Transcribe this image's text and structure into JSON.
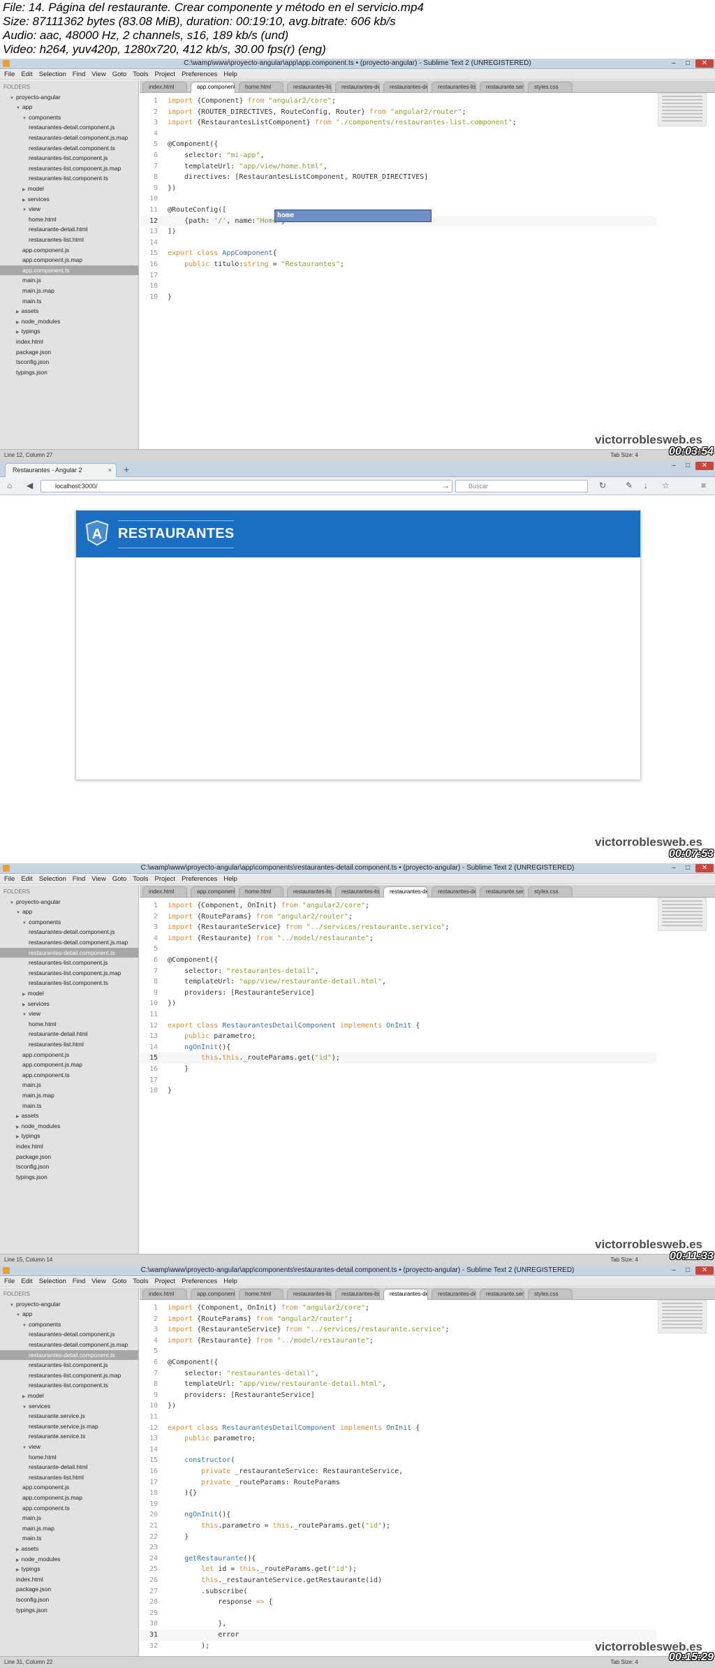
{
  "file_info": {
    "lines": [
      "File: 14. Página del restaurante. Crear componente y método en el servicio.mp4",
      "Size: 87111362 bytes (83.08 MiB), duration: 00:19:10, avg.bitrate: 606 kb/s",
      "Audio: aac, 48000 Hz, 2 channels, s16, 189 kb/s (und)",
      "Video: h264, yuv420p, 1280x720, 412 kb/s, 30.00 fps(r) (eng)"
    ]
  },
  "watermark": "victorroblesweb.es",
  "menu": [
    "File",
    "Edit",
    "Selection",
    "Find",
    "View",
    "Goto",
    "Tools",
    "Project",
    "Preferences",
    "Help"
  ],
  "window_controls": {
    "minimize": "–",
    "maximize": "□",
    "close": "✕"
  },
  "tree_icons": {
    "open": "▼",
    "closed": "▶"
  },
  "frames": [
    {
      "timestamp": "00:03:54",
      "title": "C:\\wamp\\www\\proyecto-angular\\app\\app.component.ts • (proyecto-angular) - Sublime Text 2 (UNREGISTERED)",
      "status_left": "Line 12, Column 27",
      "status_right": "Tab Size: 4",
      "tabs": [
        "index.html",
        "app.component.ts",
        "home.html",
        "restaurantes-list.co",
        "restaurantes-detail",
        "restaurantes-detail",
        "restaurantes-list.ht",
        "restaurante.service",
        "styles.css"
      ],
      "active_tab": 1,
      "sidebar": [
        {
          "t": "FOLDERS",
          "d": 0,
          "label": true
        },
        {
          "t": "proyecto-angular",
          "d": 1,
          "f": "open"
        },
        {
          "t": "app",
          "d": 2,
          "f": "open"
        },
        {
          "t": "components",
          "d": 3,
          "f": "open"
        },
        {
          "t": "restaurantes-detail.component.js",
          "d": 4
        },
        {
          "t": "restaurantes-detail.component.js.map",
          "d": 4
        },
        {
          "t": "restaurantes-detail.component.ts",
          "d": 4
        },
        {
          "t": "restaurantes-list.component.js",
          "d": 4
        },
        {
          "t": "restaurantes-list.component.js.map",
          "d": 4
        },
        {
          "t": "restaurantes-list.component.ts",
          "d": 4
        },
        {
          "t": "model",
          "d": 3,
          "f": "closed"
        },
        {
          "t": "services",
          "d": 3,
          "f": "closed"
        },
        {
          "t": "view",
          "d": 3,
          "f": "open"
        },
        {
          "t": "home.html",
          "d": 4
        },
        {
          "t": "restaurante-detail.html",
          "d": 4
        },
        {
          "t": "restaurantes-list.html",
          "d": 4
        },
        {
          "t": "app.component.js",
          "d": 3
        },
        {
          "t": "app.component.js.map",
          "d": 3
        },
        {
          "t": "app.component.ts",
          "d": 3,
          "sel": true
        },
        {
          "t": "main.js",
          "d": 3
        },
        {
          "t": "main.js.map",
          "d": 3
        },
        {
          "t": "main.ts",
          "d": 3
        },
        {
          "t": "assets",
          "d": 2,
          "f": "closed"
        },
        {
          "t": "node_modules",
          "d": 2,
          "f": "closed"
        },
        {
          "t": "typings",
          "d": 2,
          "f": "closed"
        },
        {
          "t": "index.html",
          "d": 2
        },
        {
          "t": "package.json",
          "d": 2
        },
        {
          "t": "tsconfig.json",
          "d": 2
        },
        {
          "t": "typings.json",
          "d": 2
        }
      ],
      "current_line": 12,
      "autocomplete": "home",
      "code": [
        "<span class=\"k\">import</span> {Component} <span class=\"k\">from</span> <span class=\"s\">\"angular2/core\"</span>;",
        "<span class=\"k\">import</span> {ROUTER_DIRECTIVES, RouteConfig, Router} <span class=\"k\">from</span> <span class=\"s\">\"angular2/router\"</span>;",
        "<span class=\"k\">import</span> {RestaurantesListComponent} <span class=\"k\">from</span> <span class=\"s\">\"./components/restaurantes-list.component\"</span>;",
        "",
        "@Component({",
        "    selector: <span class=\"s\">\"mi-app\"</span>,",
        "    templateUrl: <span class=\"s\">\"app/view/home.html\"</span>,",
        "    directives: [RestaurantesListComponent, ROUTER_DIRECTIVES]",
        "})",
        "",
        "@RouteConfig([",
        "    {path: <span class=\"s\">'/'</span>, name:<span class=\"s\">\"Home\"</span>}",
        "])",
        "",
        "<span class=\"k\">export</span> <span class=\"k\">class</span> <span class=\"t\">AppComponent</span>{",
        "    <span class=\"k\">public</span> titulo:<span class=\"k\">string</span> = <span class=\"s\">\"Restaurantes\"</span>;",
        "",
        "",
        "}"
      ]
    },
    {
      "timestamp": "00:07:53",
      "tab_title": "Restaurantes - Angular 2",
      "tab_close": "×",
      "new_tab": "+",
      "url": "localhost:3000/",
      "search_placeholder": "Buscar",
      "brand": "RESTAURANTES",
      "logo_letter": "A",
      "nav_icons": {
        "back": "◀",
        "forward": "▶",
        "reload": "↻",
        "go": "→",
        "home": "⌂",
        "bookmark": "☆",
        "menu": "≡",
        "download": "↓",
        "tools": "✎",
        "search": "⌕"
      }
    },
    {
      "timestamp": "00:11:33",
      "title": "C:\\wamp\\www\\proyecto-angular\\app\\components\\restaurantes-detail.component.ts • (proyecto-angular) - Sublime Text 2 (UNREGISTERED)",
      "status_left": "Line 15, Column 14",
      "status_right": "Tab Size: 4",
      "tabs": [
        "index.html",
        "app.component.ts",
        "home.html",
        "restaurantes-list.co",
        "restaurantes-list.ht",
        "restaurantes-detail",
        "restaurantes-detail",
        "restaurante.service",
        "styles.css"
      ],
      "active_tab": 5,
      "sidebar": [
        {
          "t": "FOLDERS",
          "d": 0,
          "label": true
        },
        {
          "t": "proyecto-angular",
          "d": 1,
          "f": "open"
        },
        {
          "t": "app",
          "d": 2,
          "f": "open"
        },
        {
          "t": "components",
          "d": 3,
          "f": "open"
        },
        {
          "t": "restaurantes-detail.component.js",
          "d": 4
        },
        {
          "t": "restaurantes-detail.component.js.map",
          "d": 4
        },
        {
          "t": "restaurantes-detail.component.ts",
          "d": 4,
          "sel": true
        },
        {
          "t": "restaurantes-list.component.js",
          "d": 4
        },
        {
          "t": "restaurantes-list.component.js.map",
          "d": 4
        },
        {
          "t": "restaurantes-list.component.ts",
          "d": 4
        },
        {
          "t": "model",
          "d": 3,
          "f": "closed"
        },
        {
          "t": "services",
          "d": 3,
          "f": "closed"
        },
        {
          "t": "view",
          "d": 3,
          "f": "open"
        },
        {
          "t": "home.html",
          "d": 4
        },
        {
          "t": "restaurante-detail.html",
          "d": 4
        },
        {
          "t": "restaurantes-list.html",
          "d": 4
        },
        {
          "t": "app.component.js",
          "d": 3
        },
        {
          "t": "app.component.js.map",
          "d": 3
        },
        {
          "t": "app.component.ts",
          "d": 3
        },
        {
          "t": "main.js",
          "d": 3
        },
        {
          "t": "main.js.map",
          "d": 3
        },
        {
          "t": "main.ts",
          "d": 3
        },
        {
          "t": "assets",
          "d": 2,
          "f": "closed"
        },
        {
          "t": "node_modules",
          "d": 2,
          "f": "closed"
        },
        {
          "t": "typings",
          "d": 2,
          "f": "closed"
        },
        {
          "t": "index.html",
          "d": 2
        },
        {
          "t": "package.json",
          "d": 2
        },
        {
          "t": "tsconfig.json",
          "d": 2
        },
        {
          "t": "typings.json",
          "d": 2
        }
      ],
      "current_line": 15,
      "code": [
        "<span class=\"k\">import</span> {Component, OnInit} <span class=\"k\">from</span> <span class=\"s\">\"angular2/core\"</span>;",
        "<span class=\"k\">import</span> {RouteParams} <span class=\"k\">from</span> <span class=\"s\">\"angular2/router\"</span>;",
        "<span class=\"k\">import</span> {RestauranteService} <span class=\"k\">from</span> <span class=\"s\">\"../services/restaurante.service\"</span>;",
        "<span class=\"k\">import</span> {Restaurante} <span class=\"k\">from</span> <span class=\"s\">\"../model/restaurante\"</span>;",
        "",
        "@Component({",
        "    selector: <span class=\"s\">\"restaurantes-detail\"</span>,",
        "    templateUrl: <span class=\"s\">\"app/view/restaurante-detail.html\"</span>,",
        "    providers: [RestauranteService]",
        "})",
        "",
        "<span class=\"k\">export</span> <span class=\"k\">class</span> <span class=\"t\">RestaurantesDetailComponent</span> <span class=\"k\">implements</span> <span class=\"t\">OnInit</span> {",
        "    <span class=\"k\">public</span> parametro;",
        "    <span class=\"t\">ngOnInit</span>(){",
        "        <span class=\"k\">this</span>.<span class=\"k\">this</span>._routeParams.get(<span class=\"s\">\"id\"</span>);",
        "    }",
        "",
        "}"
      ]
    },
    {
      "timestamp": "00:15:29",
      "title": "C:\\wamp\\www\\proyecto-angular\\app\\components\\restaurantes-detail.component.ts • (proyecto-angular) - Sublime Text 2 (UNREGISTERED)",
      "status_left": "Line 31, Column 22",
      "status_right": "Tab Size: 4",
      "tabs": [
        "index.html",
        "app.component.ts",
        "home.html",
        "restaurantes-list.co",
        "restaurantes-list.ht",
        "restaurantes-detail",
        "restaurantes-detail",
        "restaurante.service",
        "styles.css"
      ],
      "active_tab": 5,
      "sidebar": [
        {
          "t": "FOLDERS",
          "d": 0,
          "label": true
        },
        {
          "t": "proyecto-angular",
          "d": 1,
          "f": "open"
        },
        {
          "t": "app",
          "d": 2,
          "f": "open"
        },
        {
          "t": "components",
          "d": 3,
          "f": "open"
        },
        {
          "t": "restaurantes-detail.component.js",
          "d": 4
        },
        {
          "t": "restaurantes-detail.component.js.map",
          "d": 4
        },
        {
          "t": "restaurantes-detail.component.ts",
          "d": 4,
          "sel": true
        },
        {
          "t": "restaurantes-list.component.js",
          "d": 4
        },
        {
          "t": "restaurantes-list.component.js.map",
          "d": 4
        },
        {
          "t": "restaurantes-list.component.ts",
          "d": 4
        },
        {
          "t": "model",
          "d": 3,
          "f": "closed"
        },
        {
          "t": "services",
          "d": 3,
          "f": "open"
        },
        {
          "t": "restaurante.service.js",
          "d": 4
        },
        {
          "t": "restaurante.service.js.map",
          "d": 4
        },
        {
          "t": "restaurante.service.ts",
          "d": 4
        },
        {
          "t": "view",
          "d": 3,
          "f": "open"
        },
        {
          "t": "home.html",
          "d": 4
        },
        {
          "t": "restaurante-detail.html",
          "d": 4
        },
        {
          "t": "restaurantes-list.html",
          "d": 4
        },
        {
          "t": "app.component.js",
          "d": 3
        },
        {
          "t": "app.component.js.map",
          "d": 3
        },
        {
          "t": "app.component.ts",
          "d": 3
        },
        {
          "t": "main.js",
          "d": 3
        },
        {
          "t": "main.js.map",
          "d": 3
        },
        {
          "t": "main.ts",
          "d": 3
        },
        {
          "t": "assets",
          "d": 2,
          "f": "closed"
        },
        {
          "t": "node_modules",
          "d": 2,
          "f": "closed"
        },
        {
          "t": "typings",
          "d": 2,
          "f": "closed"
        },
        {
          "t": "index.html",
          "d": 2
        },
        {
          "t": "package.json",
          "d": 2
        },
        {
          "t": "tsconfig.json",
          "d": 2
        },
        {
          "t": "typings.json",
          "d": 2
        }
      ],
      "current_line": 31,
      "code": [
        "<span class=\"k\">import</span> {Component, OnInit} <span class=\"k\">from</span> <span class=\"s\">\"angular2/core\"</span>;",
        "<span class=\"k\">import</span> {RouteParams} <span class=\"k\">from</span> <span class=\"s\">\"angular2/router\"</span>;",
        "<span class=\"k\">import</span> {RestauranteService} <span class=\"k\">from</span> <span class=\"s\">\"../services/restaurante.service\"</span>;",
        "<span class=\"k\">import</span> {Restaurante} <span class=\"k\">from</span> <span class=\"s\">\"../model/restaurante\"</span>;",
        "",
        "@Component({",
        "    selector: <span class=\"s\">\"restaurantes-detail\"</span>,",
        "    templateUrl: <span class=\"s\">\"app/view/restaurante-detail.html\"</span>,",
        "    providers: [RestauranteService]",
        "})",
        "",
        "<span class=\"k\">export</span> <span class=\"k\">class</span> <span class=\"t\">RestaurantesDetailComponent</span> <span class=\"k\">implements</span> <span class=\"t\">OnInit</span> {",
        "    <span class=\"k\">public</span> parametro;",
        "",
        "    <span class=\"t\">constructor</span>(",
        "        <span class=\"k\">private</span> _restauranteService: RestauranteService,",
        "        <span class=\"k\">private</span> _routeParams: RouteParams",
        "    ){}",
        "",
        "    <span class=\"t\">ngOnInit</span>(){",
        "        <span class=\"k\">this</span>.parametro = <span class=\"k\">this</span>._routeParams.get(<span class=\"s\">\"id\"</span>);",
        "    }",
        "",
        "    <span class=\"t\">getRestaurante</span>(){",
        "        <span class=\"k\">let</span> id = <span class=\"k\">this</span>._routeParams.get(<span class=\"s\">\"id\"</span>);",
        "        <span class=\"k\">this</span>._restauranteService.getRestaurante(id)",
        "        .subscribe(",
        "            response <span class=\"k\">=></span> {",
        "",
        "            },",
        "            error",
        "        );"
      ]
    }
  ]
}
